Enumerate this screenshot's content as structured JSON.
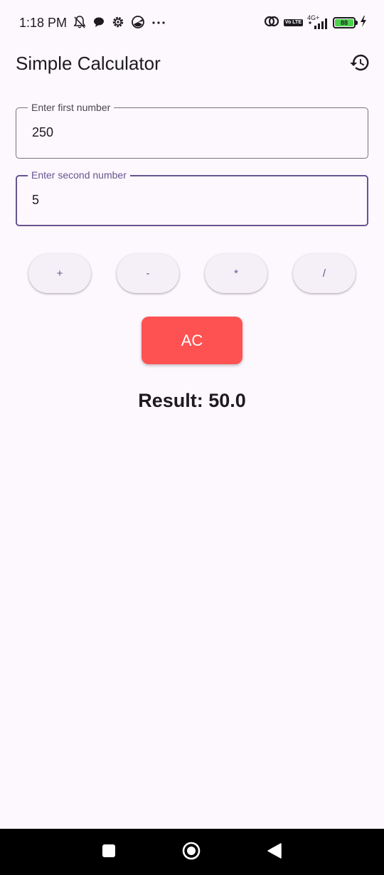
{
  "status_bar": {
    "time": "1:18 PM",
    "network": "4G+",
    "volte": "Vo LTE",
    "battery": "88"
  },
  "app_bar": {
    "title": "Simple Calculator",
    "history_icon": "history-icon"
  },
  "fields": {
    "first": {
      "label": "Enter first number",
      "value": "250"
    },
    "second": {
      "label": "Enter second number",
      "value": "5"
    }
  },
  "operators": [
    "+",
    "-",
    "*",
    "/"
  ],
  "clear_label": "AC",
  "result_text": "Result: 50.0",
  "colors": {
    "background": "#fdf7fe",
    "primary": "#65558f",
    "clear_button": "#fe5252",
    "operator_button": "#f5eff7"
  },
  "nav": {
    "recents_icon": "square-icon",
    "home_icon": "circle-icon",
    "back_icon": "triangle-back-icon"
  }
}
